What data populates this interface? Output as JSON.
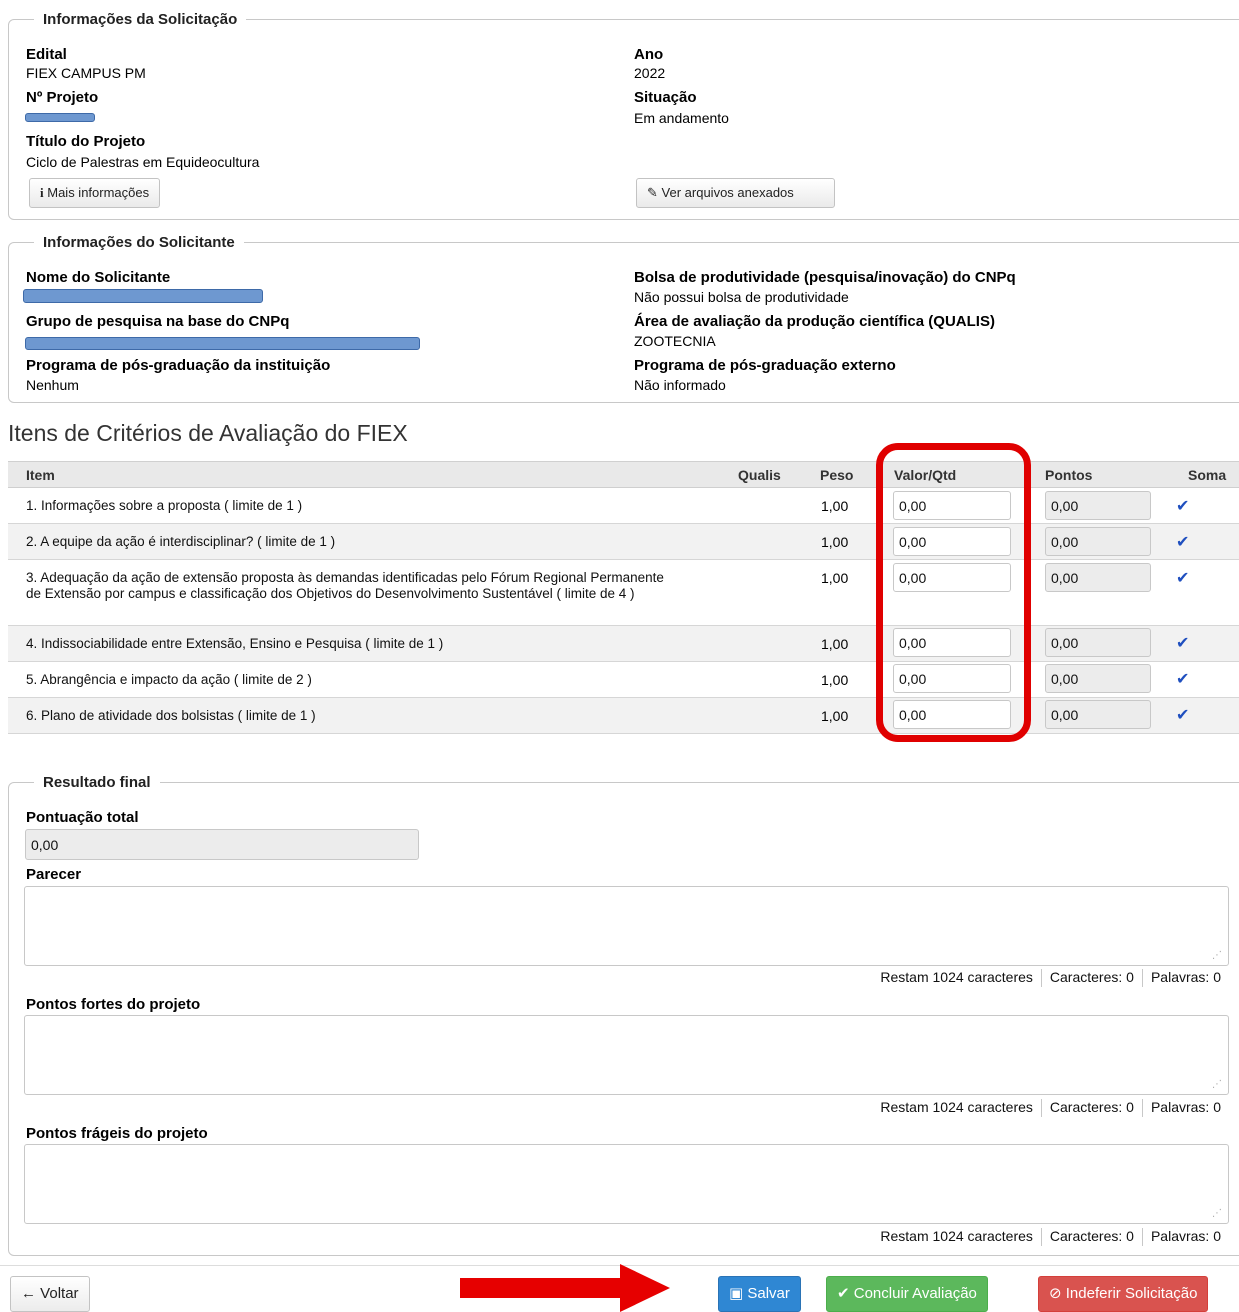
{
  "solicitacao": {
    "legend": "Informações da Solicitação",
    "edital_label": "Edital",
    "edital_value": "FIEX CAMPUS PM",
    "ano_label": "Ano",
    "ano_value": "2022",
    "projeto_label": "Nº Projeto",
    "situacao_label": "Situação",
    "situacao_value": "Em andamento",
    "titulo_label": "Título do Projeto",
    "titulo_value": "Ciclo de Palestras em Equideocultura",
    "mais_info_button": "Mais informações",
    "ver_arquivos_button": "Ver arquivos anexados"
  },
  "solicitante": {
    "legend": "Informações do Solicitante",
    "nome_label": "Nome do Solicitante",
    "bolsa_label": "Bolsa de produtividade (pesquisa/inovação) do CNPq",
    "bolsa_value": "Não possui bolsa de produtividade",
    "grupo_label": "Grupo de pesquisa na base do CNPq",
    "area_label": "Área de avaliação da produção científica (QUALIS)",
    "area_value": "ZOOTECNIA",
    "prog_inst_label": "Programa de pós-graduação da instituição",
    "prog_inst_value": "Nenhum",
    "prog_ext_label": "Programa de pós-graduação externo",
    "prog_ext_value": "Não informado"
  },
  "criterios": {
    "title": "Itens de Critérios de Avaliação do FIEX",
    "headers": {
      "item": "Item",
      "qualis": "Qualis",
      "peso": "Peso",
      "valor": "Valor/Qtd",
      "pontos": "Pontos",
      "soma": "Soma"
    },
    "rows": [
      {
        "item": "1. Informações sobre a proposta ( limite de 1 )",
        "peso": "1,00",
        "valor": "0,00",
        "pontos": "0,00"
      },
      {
        "item": "2. A equipe da ação é interdisciplinar? ( limite de 1 )",
        "peso": "1,00",
        "valor": "0,00",
        "pontos": "0,00"
      },
      {
        "item": "3. Adequação da ação de extensão proposta às demandas identificadas pelo Fórum Regional Permanente de Extensão por campus e classificação dos Objetivos do Desenvolvimento Sustentável ( limite de 4 )",
        "peso": "1,00",
        "valor": "0,00",
        "pontos": "0,00"
      },
      {
        "item": "4. Indissociabilidade entre Extensão, Ensino e Pesquisa ( limite de 1 )",
        "peso": "1,00",
        "valor": "0,00",
        "pontos": "0,00"
      },
      {
        "item": "5. Abrangência e impacto da ação ( limite de 2 )",
        "peso": "1,00",
        "valor": "0,00",
        "pontos": "0,00"
      },
      {
        "item": "6. Plano de atividade dos bolsistas ( limite de 1 )",
        "peso": "1,00",
        "valor": "0,00",
        "pontos": "0,00"
      }
    ],
    "check_icon": "check-icon",
    "highlight_color": "#e00000"
  },
  "resultado": {
    "legend": "Resultado final",
    "pontuacao_label": "Pontuação total",
    "pontuacao_value": "0,00",
    "parecer_label": "Parecer",
    "fortes_label": "Pontos fortes do projeto",
    "frageis_label": "Pontos frágeis do projeto",
    "restam": "Restam 1024 caracteres",
    "caracteres": "Caracteres: 0",
    "palavras": "Palavras: 0"
  },
  "actions": {
    "voltar": "Voltar",
    "salvar": "Salvar",
    "concluir": "Concluir Avaliação",
    "indeferir": "Indeferir Solicitação",
    "save_color": "#2f87d3",
    "concluir_color": "#5cb85c",
    "indeferir_color": "#d9534f",
    "arrow_color": "#e60000"
  }
}
